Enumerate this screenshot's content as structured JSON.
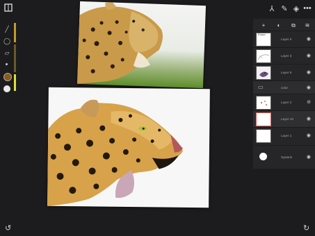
{
  "app": {
    "top_icons": [
      "brush-settings-icon",
      "pin-icon",
      "layers-icon",
      "more-icon"
    ],
    "top_glyphs": [
      "⅄",
      "✎",
      "◈",
      "•••"
    ]
  },
  "toolbar": {
    "tools": [
      "brush-icon",
      "lasso-icon",
      "eraser-icon"
    ],
    "glyphs": [
      "╱",
      "◯",
      "▱"
    ],
    "undo_glyph": "↺",
    "redo_glyph": "↻"
  },
  "colors": {
    "primary": "#8a5a17",
    "accent_bar": [
      "#c49a2a",
      "#6b5a2a",
      "#e0dc3c"
    ],
    "selected_layer": "#e05a4f"
  },
  "layers_panel": {
    "tool_glyphs": [
      "+",
      "◐",
      "⧉",
      "≋"
    ],
    "layers": [
      {
        "name": "Layer 6",
        "note": "Roppo",
        "kind": "sketch"
      },
      {
        "name": "Layer 3",
        "note": "",
        "kind": "sketch"
      },
      {
        "name": "Layer 8",
        "note": "",
        "kind": "photo"
      },
      {
        "name": "color",
        "note": "",
        "kind": "folder"
      },
      {
        "name": "Layer 2",
        "note": "",
        "kind": "sketch"
      },
      {
        "name": "Layer 10",
        "note": "",
        "kind": "selected"
      },
      {
        "name": "Layer 1",
        "note": "",
        "kind": "blank"
      },
      {
        "name": "Sywaris",
        "note": "",
        "kind": "background"
      }
    ],
    "eye_glyph": "◉",
    "hidden_eye_glyph": "⊘"
  }
}
